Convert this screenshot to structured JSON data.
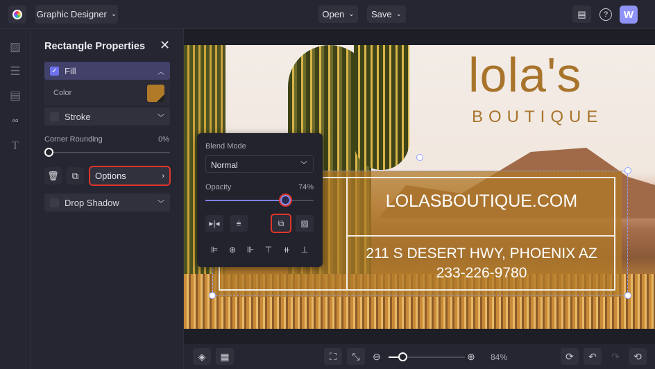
{
  "topbar": {
    "project_type": "Graphic Designer",
    "open_label": "Open",
    "save_label": "Save",
    "avatar_letter": "W"
  },
  "panel": {
    "title": "Rectangle Properties",
    "fill_label": "Fill",
    "color_label": "Color",
    "fill_color": "#b07a28",
    "stroke_label": "Stroke",
    "corner_rounding_label": "Corner Rounding",
    "corner_rounding_value": "0%",
    "corner_rounding": 0,
    "options_label": "Options",
    "drop_shadow_label": "Drop Shadow"
  },
  "popup": {
    "blend_mode_label": "Blend Mode",
    "blend_mode_value": "Normal",
    "opacity_label": "Opacity",
    "opacity_value": "74%",
    "opacity": 74
  },
  "canvas": {
    "brand_name": "lola's",
    "brand_sub": "BOUTIQUE",
    "website": "LOLASBOUTIQUE.COM",
    "address": "211 S DESERT HWY, PHOENIX AZ",
    "phone": "233-226-9780"
  },
  "bottombar": {
    "zoom_value": "84%"
  },
  "colors": {
    "accent": "#6f72f0",
    "highlight": "#e0352b",
    "brand": "#a8742c"
  }
}
